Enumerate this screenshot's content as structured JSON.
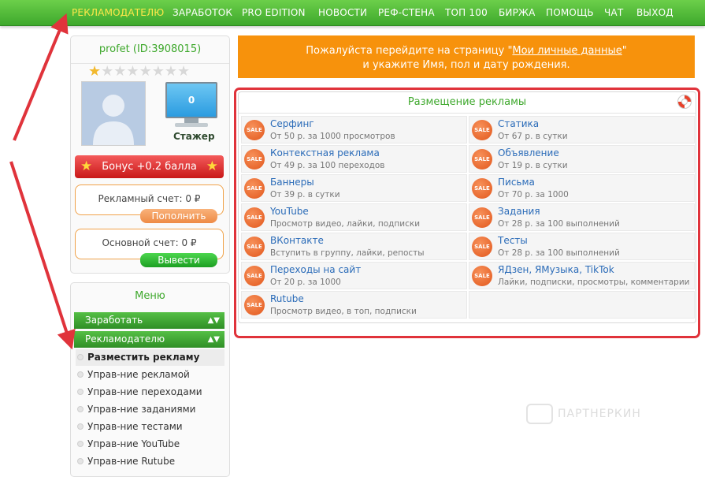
{
  "nav": {
    "items": [
      {
        "label": "РЕКЛАМОДАТЕЛЮ",
        "active": true
      },
      {
        "label": "ЗАРАБОТОК"
      },
      {
        "label": "PRO EDITION"
      },
      {
        "label": "НОВОСТИ"
      },
      {
        "label": "РЕФ-СТЕНА"
      },
      {
        "label": "ТОП 100"
      },
      {
        "label": "БИРЖА"
      },
      {
        "label": "ПОМОЩЬ"
      },
      {
        "label": "ЧАТ"
      },
      {
        "label": "ВЫХОД"
      }
    ],
    "active_color": "#ffe84a",
    "bar_color": "#4cb83a"
  },
  "profile": {
    "username": "profet",
    "user_id": "(ID:3908015)",
    "stars_on": 1,
    "stars_total": 8,
    "level": "0",
    "rank": "Стажер",
    "bonus": "Бонус +0.2 балла",
    "ad_account_label": "Рекламный счет: 0 ₽",
    "ad_account_button": "Пополнить",
    "main_account_label": "Основной счет: 0 ₽",
    "main_account_button": "Вывести"
  },
  "menu": {
    "title": "Меню",
    "headers": [
      {
        "label": "Заработать",
        "arrows": "▲▼"
      },
      {
        "label": "Рекламодателю",
        "arrows": "▲▼"
      }
    ],
    "items": [
      {
        "label": "Разместить рекламу",
        "selected": true
      },
      {
        "label": "Управ-ние рекламой"
      },
      {
        "label": "Управ-ние переходами"
      },
      {
        "label": "Управ-ние заданиями"
      },
      {
        "label": "Управ-ние тестами"
      },
      {
        "label": "Управ-ние YouTube"
      },
      {
        "label": "Управ-ние Rutube"
      }
    ]
  },
  "notice": {
    "line1_prefix": "Пожалуйста перейдите на страницу \"",
    "line1_link": "Мои личные данные",
    "line1_suffix": "\"",
    "line2": "и укажите Имя, пол и дату рождения.",
    "bg": "#f7920c"
  },
  "ads": {
    "title": "Размещение рекламы",
    "sale_label": "SALE",
    "left": [
      {
        "title": "Серфинг",
        "sub": "От 50 р. за 1000 просмотров"
      },
      {
        "title": "Контекстная реклама",
        "sub": "От 49 р. за 100 переходов"
      },
      {
        "title": "Баннеры",
        "sub": "От 39 р. в сутки"
      },
      {
        "title": "YouTube",
        "sub": "Просмотр видео, лайки, подписки"
      },
      {
        "title": "ВКонтакте",
        "sub": "Вступить в группу, лайки, репосты"
      },
      {
        "title": "Переходы на сайт",
        "sub": "От 20 р. за 1000"
      },
      {
        "title": "Rutube",
        "sub": "Просмотр видео, в топ, подписки"
      }
    ],
    "right": [
      {
        "title": "Статика",
        "sub": "От 67 р. в сутки"
      },
      {
        "title": "Объявление",
        "sub": "От 19 р. в сутки"
      },
      {
        "title": "Письма",
        "sub": "От 70 р. за 1000"
      },
      {
        "title": "Задания",
        "sub": "От 28 р. за 100 выполнений"
      },
      {
        "title": "Тесты",
        "sub": "От 28 р. за 100 выполнений"
      },
      {
        "title": "ЯДзен, ЯМузыка, TikTok",
        "sub": "Лайки, подписки, просмотры, комментарии"
      }
    ],
    "highlight_color": "#e0333b",
    "link_color": "#2a6bb8"
  },
  "watermark": "ПАРТНЕРКИН"
}
